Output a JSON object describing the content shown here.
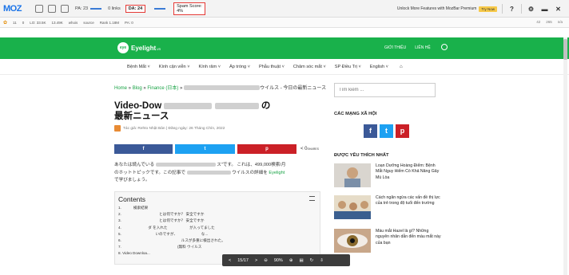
{
  "moz": {
    "logo": "MOZ",
    "pa": "PA: 23",
    "links": "0 links",
    "da": "DA: 24",
    "spam_score_label": "Spam Score:",
    "spam_score_value": "4%",
    "unlock": "Unlock More Features with MozBar Premium",
    "try": "Try Now",
    "help": "?",
    "row2": [
      "11",
      "0",
      "LO: 33.5K",
      "13.49K",
      "whois",
      "source",
      "Rank 1.18M",
      "PA: 0"
    ],
    "row2_right": [
      "42",
      "265",
      "n/a"
    ]
  },
  "site": {
    "logo_mark": "eye",
    "logo_text": "Eyelight",
    "logo_suffix": ".vn",
    "top_links": [
      "GIỚI THIỆU",
      "LIÊN HỆ"
    ],
    "nav": [
      "Bệnh Mắt ˅",
      "Kính cận viễn ˅",
      "Kính râm ˅",
      "Áp tròng ˅",
      "Phẫu thuật ˅",
      "Chăm sóc mắt ˅",
      "SP Điều Trị ˅",
      "English ˅"
    ],
    "home_icon": "⌂"
  },
  "article": {
    "breadcrumb_home": "Home",
    "breadcrumb_sep1": " » ",
    "breadcrumb_blog": "Blog",
    "breadcrumb_sep2": " » ",
    "breadcrumb_cat": "Finance (日本)",
    "breadcrumb_sep3": " » ",
    "breadcrumb_tail": "ウイルス - 今日の最新ニュース",
    "title_line1": "Video-Dow",
    "title_line2_tail": "の",
    "title_line3": "最新ニュース",
    "author_prefix": "Tác giả:",
    "author": "Rehto Nhật Bản",
    "date_prefix": "| Đăng ngày:",
    "date": "26 Tháng Chín, 2022",
    "share_fb": "f",
    "share_tw": "t",
    "share_pin": "p",
    "share_count": "0",
    "share_count_label": "SHARES",
    "intro_1": "あなたは読んでいる",
    "intro_2": "ス\"です。 これは、499,000検索/月",
    "intro_3": "のホットトピックです。この記事で",
    "intro_4": "ウイルスの詳細を",
    "intro_link": "Eyelight",
    "intro_5": "で学びましょう。"
  },
  "toc": {
    "title": "Contents",
    "items": [
      "1. 　　　検索結果",
      "2. 　　　　　　　　　　とは何ですか？ 安全ですか",
      "3. 　　　　　　　　　　とは何ですか？ 安全ですか",
      "4. 　　　　　　　ダ を入れた　　　　　　が入ってました",
      "5. 　　　　　　　　　いのですが、　　　　　　　な...",
      "6. 　　　　　　　　　　　　　　　　ルスが多重に検出された。",
      "7. 　　　　　　　　　　　　　　　(無料 ウイルス",
      "8. Video Downloa..."
    ]
  },
  "sidebar": {
    "search_placeholder": "Tìm kiếm ...",
    "social_heading": "CÁC MẠNG XÃ HỘI",
    "social": [
      "f",
      "t",
      "p"
    ],
    "popular_heading": "ĐƯỢC YÊU THÍCH NHẤT",
    "popular": [
      "Loạn Dưỡng Hoàng Điểm: Bệnh Mắt Nguy Hiểm Có Khả Năng Gây Mù Lòa",
      "Cách ngăn ngừa các vấn đề thị lực của trẻ trong độ tuổi đến trường",
      "Màu mắt Hazel là gì? Những nguyên nhân dẫn đến màu mắt này của bạn"
    ]
  },
  "pdf": {
    "prev": "<",
    "page": "15/17",
    "next": ">",
    "zoom_out": "⊖",
    "zoom": "90%",
    "zoom_in": "⊕",
    "fit": "▤",
    "rotate": "↻",
    "download": "⇩"
  },
  "colors": {
    "brand": "#19b14b",
    "moz_highlight": "#e53935"
  }
}
